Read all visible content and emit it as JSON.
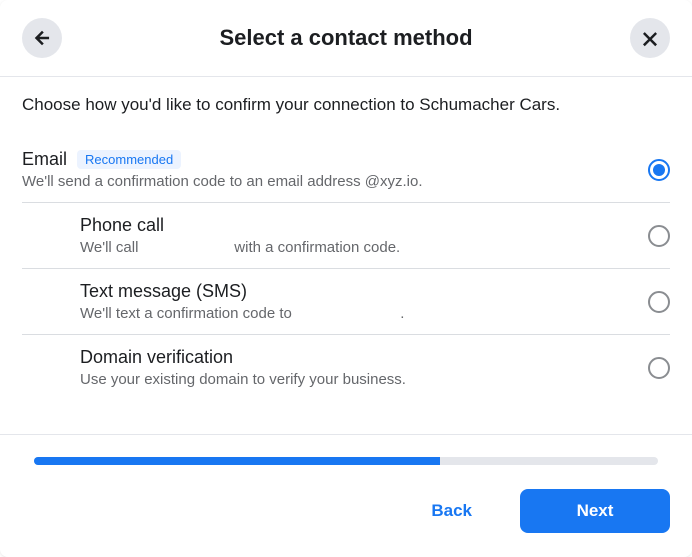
{
  "header": {
    "title": "Select a contact method"
  },
  "instruction": "Choose how you'd like to confirm your connection to Schumacher Cars.",
  "options": [
    {
      "title": "Email",
      "badge": "Recommended",
      "desc": "We'll send a confirmation code to an email address @xyz.io.",
      "selected": true
    },
    {
      "title": "Phone call",
      "desc": "We'll call                       with a confirmation code.",
      "selected": false
    },
    {
      "title": "Text message (SMS)",
      "desc": "We'll text a confirmation code to                          .",
      "selected": false
    },
    {
      "title": "Domain verification",
      "desc": "Use your existing domain to verify your business.",
      "selected": false
    }
  ],
  "progress_percent": 65,
  "footer": {
    "back": "Back",
    "next": "Next"
  }
}
